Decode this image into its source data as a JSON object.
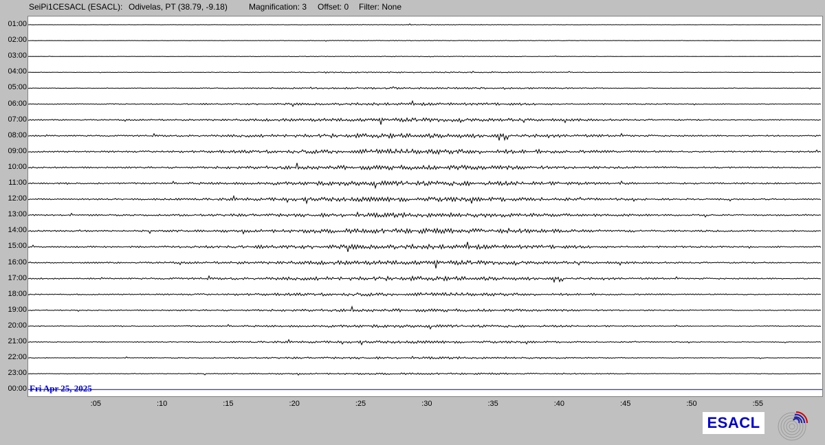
{
  "header": {
    "station": "SeiPi1CESACL (ESACL):",
    "location": "Odivelas, PT (38.79, -9.18)",
    "magnification": "Magnification: 3",
    "offset": "Offset: 0",
    "filter": "Filter: None"
  },
  "hour_labels": [
    "01:00",
    "02:00",
    "03:00",
    "04:00",
    "05:00",
    "06:00",
    "07:00",
    "08:00",
    "09:00",
    "10:00",
    "11:00",
    "12:00",
    "13:00",
    "14:00",
    "15:00",
    "16:00",
    "17:00",
    "18:00",
    "19:00",
    "20:00",
    "21:00",
    "22:00",
    "23:00",
    "00:00"
  ],
  "minute_labels": [
    ":05",
    ":10",
    ":15",
    ":20",
    ":25",
    ":30",
    ":35",
    ":40",
    ":45",
    ":50",
    ":55"
  ],
  "date_label": "Fri Apr 25, 2025",
  "logo_text": "ESACL",
  "colors": {
    "background": "#c0c0c0",
    "trace": "#000000",
    "current_trace": "#0000cc",
    "date_text": "#0000cc",
    "logo_text": "#0000cc"
  },
  "icons": {
    "emblem": "seismic-waves-emblem-icon"
  }
}
